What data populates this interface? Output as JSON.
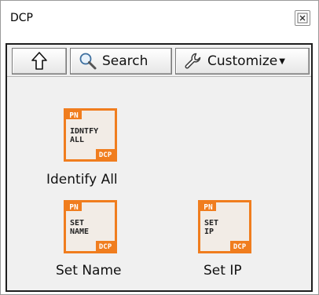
{
  "window": {
    "title": "DCP"
  },
  "toolbar": {
    "search_label": "Search",
    "customize_label": "Customize"
  },
  "items": [
    {
      "label": "Identify All",
      "icon": {
        "badge": "PN",
        "text_lines": [
          "IDNTFY",
          "ALL"
        ],
        "footer": "DCP"
      }
    },
    {
      "label": "Set Name",
      "icon": {
        "badge": "PN",
        "text_lines": [
          "SET",
          "NAME"
        ],
        "footer": "DCP"
      }
    },
    {
      "label": "Set IP",
      "icon": {
        "badge": "PN",
        "text_lines": [
          "SET",
          "IP"
        ],
        "footer": "DCP"
      }
    }
  ],
  "colors": {
    "accent": "#f07d1e",
    "icon_fill": "#f2ece6",
    "palette_bg": "#f0f0f0"
  }
}
